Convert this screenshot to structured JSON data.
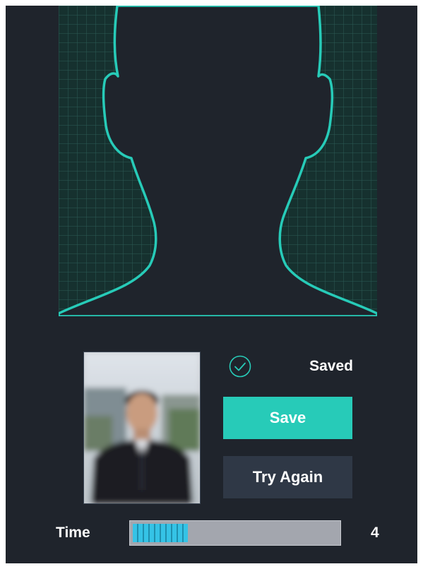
{
  "status": {
    "text": "Saved",
    "icon": "check-circle-icon"
  },
  "buttons": {
    "save_label": "Save",
    "try_again_label": "Try Again"
  },
  "timer": {
    "label": "Time",
    "remaining": "4",
    "progress_fraction": 0.27
  },
  "colors": {
    "accent": "#27cbb8",
    "background": "#1f242c",
    "secondary_button": "#2f3846",
    "progress_track": "#a3a6ae",
    "progress_fill": "#35c3e6"
  }
}
